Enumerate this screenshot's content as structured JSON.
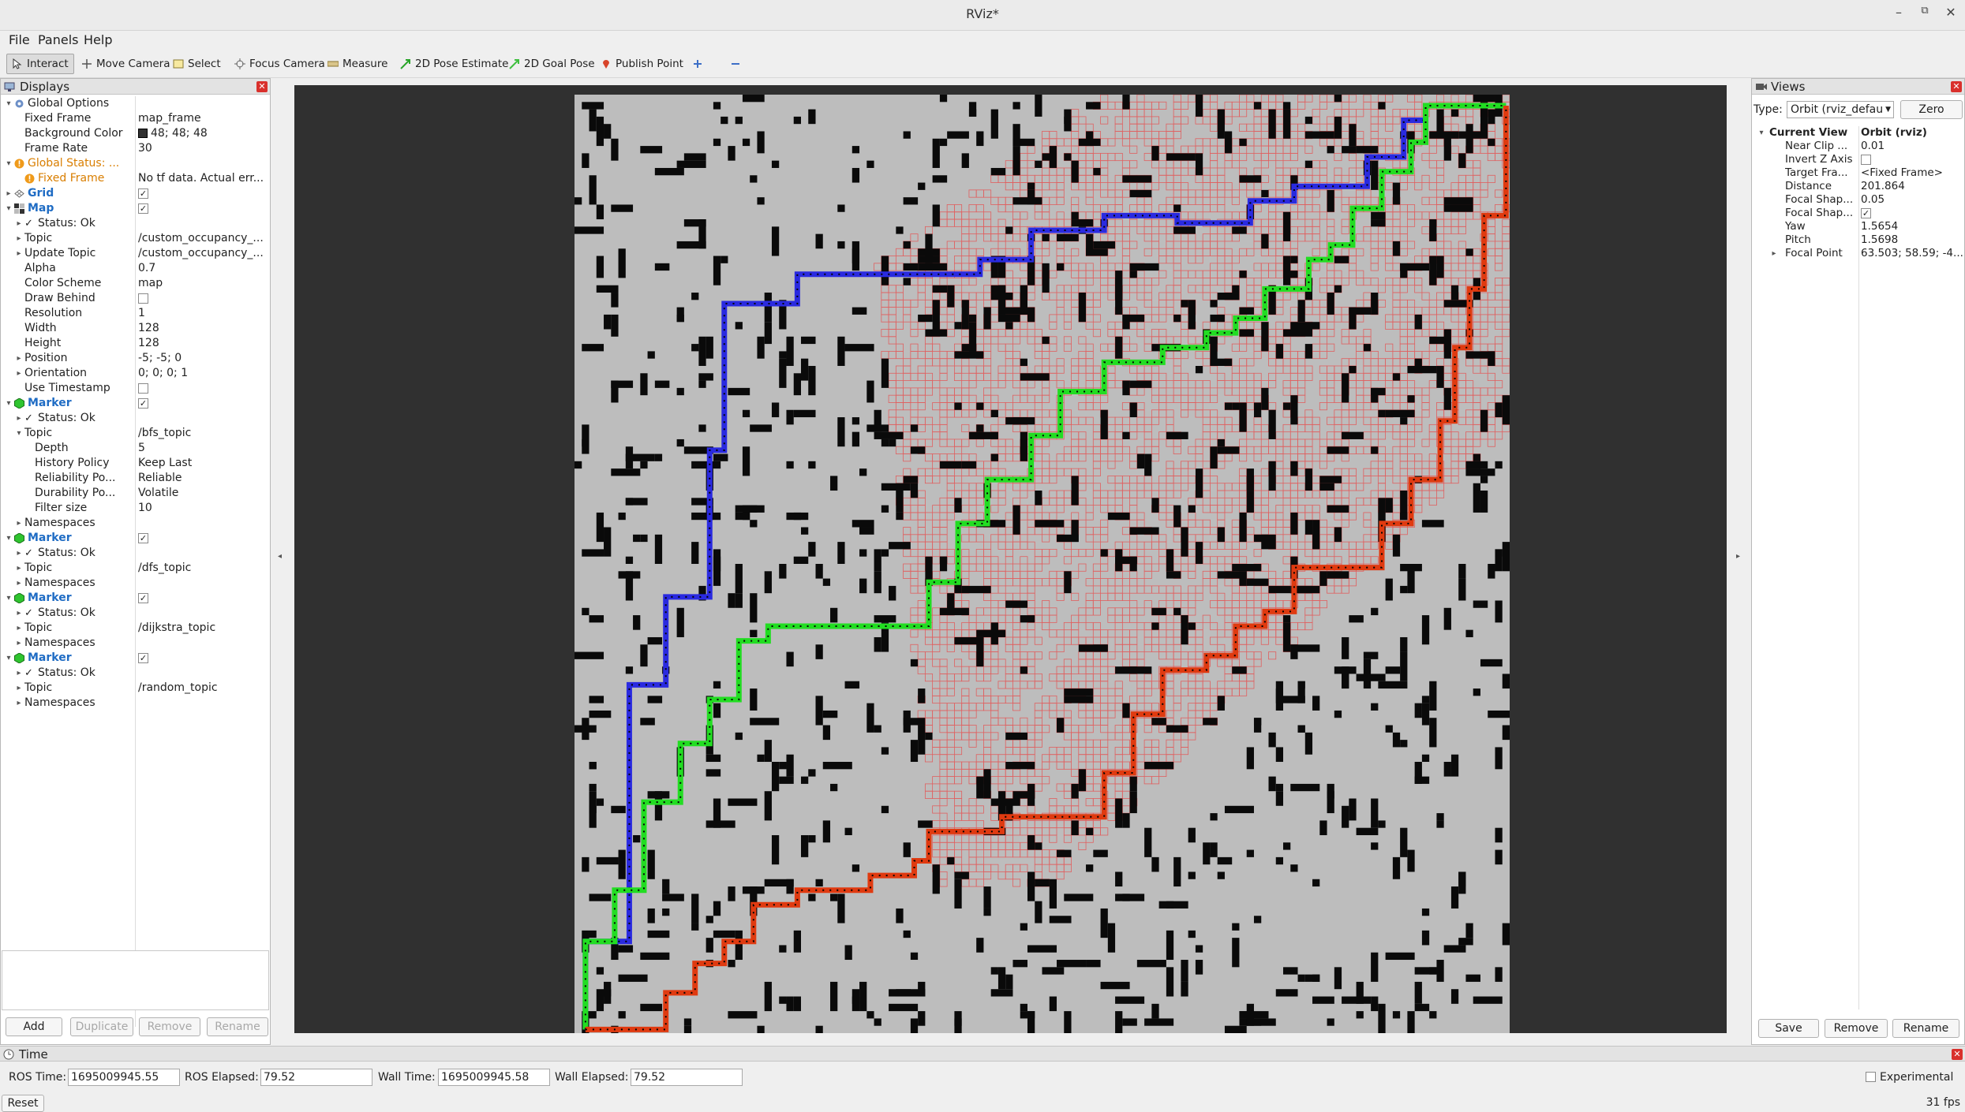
{
  "window": {
    "title": "RViz*"
  },
  "menu": [
    "File",
    "Panels",
    "Help"
  ],
  "toolbar": {
    "interact": "Interact",
    "move_camera": "Move Camera",
    "select": "Select",
    "focus_camera": "Focus Camera",
    "measure": "Measure",
    "pose_estimate": "2D Pose Estimate",
    "goal_pose": "2D Goal Pose",
    "publish_point": "Publish Point"
  },
  "displays": {
    "title": "Displays",
    "rows": [
      {
        "k": "Global Options",
        "v": "",
        "lvl": 0,
        "exp": "open",
        "icon": "gear",
        "cls": ""
      },
      {
        "k": "Fixed Frame",
        "v": "map_frame",
        "lvl": 1
      },
      {
        "k": "Background Color",
        "v": "48; 48; 48",
        "lvl": 1,
        "swatch": "#303030"
      },
      {
        "k": "Frame Rate",
        "v": "30",
        "lvl": 1
      },
      {
        "k": "Global Status: ...",
        "v": "",
        "lvl": 0,
        "exp": "open",
        "icon": "warn",
        "cls": "orange"
      },
      {
        "k": "Fixed Frame",
        "v": "No tf data.  Actual err...",
        "lvl": 1,
        "icon": "warn",
        "cls": "orange"
      },
      {
        "k": "Grid",
        "v": "",
        "lvl": 0,
        "exp": "closed",
        "icon": "grid",
        "cls": "blue",
        "check": true
      },
      {
        "k": "Map",
        "v": "",
        "lvl": 0,
        "exp": "open",
        "icon": "map",
        "cls": "blue",
        "check": true
      },
      {
        "k": "Status: Ok",
        "v": "",
        "lvl": 1,
        "exp": "closed",
        "icon": "ok"
      },
      {
        "k": "Topic",
        "v": "/custom_occupancy_...",
        "lvl": 1,
        "exp": "closed"
      },
      {
        "k": "Update Topic",
        "v": "/custom_occupancy_...",
        "lvl": 1,
        "exp": "closed"
      },
      {
        "k": "Alpha",
        "v": "0.7",
        "lvl": 1
      },
      {
        "k": "Color Scheme",
        "v": "map",
        "lvl": 1
      },
      {
        "k": "Draw Behind",
        "v": "",
        "lvl": 1,
        "check": false
      },
      {
        "k": "Resolution",
        "v": "1",
        "lvl": 1
      },
      {
        "k": "Width",
        "v": "128",
        "lvl": 1
      },
      {
        "k": "Height",
        "v": "128",
        "lvl": 1
      },
      {
        "k": "Position",
        "v": "-5; -5; 0",
        "lvl": 1,
        "exp": "closed"
      },
      {
        "k": "Orientation",
        "v": "0; 0; 0; 1",
        "lvl": 1,
        "exp": "closed"
      },
      {
        "k": "Use Timestamp",
        "v": "",
        "lvl": 1,
        "check": false
      },
      {
        "k": "Marker",
        "v": "",
        "lvl": 0,
        "exp": "open",
        "icon": "marker",
        "cls": "blue",
        "check": true
      },
      {
        "k": "Status: Ok",
        "v": "",
        "lvl": 1,
        "exp": "closed",
        "icon": "ok"
      },
      {
        "k": "Topic",
        "v": "/bfs_topic",
        "lvl": 1,
        "exp": "open"
      },
      {
        "k": "Depth",
        "v": "5",
        "lvl": 2
      },
      {
        "k": "History Policy",
        "v": "Keep Last",
        "lvl": 2
      },
      {
        "k": "Reliability Po...",
        "v": "Reliable",
        "lvl": 2
      },
      {
        "k": "Durability Po...",
        "v": "Volatile",
        "lvl": 2
      },
      {
        "k": "Filter size",
        "v": "10",
        "lvl": 2
      },
      {
        "k": "Namespaces",
        "v": "",
        "lvl": 1,
        "exp": "closed"
      },
      {
        "k": "Marker",
        "v": "",
        "lvl": 0,
        "exp": "open",
        "icon": "marker",
        "cls": "blue",
        "check": true
      },
      {
        "k": "Status: Ok",
        "v": "",
        "lvl": 1,
        "exp": "closed",
        "icon": "ok"
      },
      {
        "k": "Topic",
        "v": "/dfs_topic",
        "lvl": 1,
        "exp": "closed"
      },
      {
        "k": "Namespaces",
        "v": "",
        "lvl": 1,
        "exp": "closed"
      },
      {
        "k": "Marker",
        "v": "",
        "lvl": 0,
        "exp": "open",
        "icon": "marker",
        "cls": "blue",
        "check": true
      },
      {
        "k": "Status: Ok",
        "v": "",
        "lvl": 1,
        "exp": "closed",
        "icon": "ok"
      },
      {
        "k": "Topic",
        "v": "/dijkstra_topic",
        "lvl": 1,
        "exp": "closed"
      },
      {
        "k": "Namespaces",
        "v": "",
        "lvl": 1,
        "exp": "closed"
      },
      {
        "k": "Marker",
        "v": "",
        "lvl": 0,
        "exp": "open",
        "icon": "marker",
        "cls": "blue",
        "check": true
      },
      {
        "k": "Status: Ok",
        "v": "",
        "lvl": 1,
        "exp": "closed",
        "icon": "ok"
      },
      {
        "k": "Topic",
        "v": "/random_topic",
        "lvl": 1,
        "exp": "closed"
      },
      {
        "k": "Namespaces",
        "v": "",
        "lvl": 1,
        "exp": "closed"
      }
    ],
    "buttons": {
      "add": "Add",
      "duplicate": "Duplicate",
      "remove": "Remove",
      "rename": "Rename"
    }
  },
  "views": {
    "title": "Views",
    "type_label": "Type:",
    "type_value": "Orbit (rviz_defau",
    "zero": "Zero",
    "rows": [
      {
        "k": "Current View",
        "v": "Orbit (rviz)",
        "bold": true,
        "exp": "open"
      },
      {
        "k": "Near Clip ...",
        "v": "0.01"
      },
      {
        "k": "Invert Z Axis",
        "v": "",
        "check": false
      },
      {
        "k": "Target Fra...",
        "v": "<Fixed Frame>"
      },
      {
        "k": "Distance",
        "v": "201.864"
      },
      {
        "k": "Focal Shap...",
        "v": "0.05"
      },
      {
        "k": "Focal Shap...",
        "v": "",
        "check": true
      },
      {
        "k": "Yaw",
        "v": "1.5654"
      },
      {
        "k": "Pitch",
        "v": "1.5698"
      },
      {
        "k": "Focal Point",
        "v": "63.503; 58.59; -4...",
        "exp": "closed"
      }
    ],
    "buttons": {
      "save": "Save",
      "remove": "Remove",
      "rename": "Rename"
    }
  },
  "time": {
    "title": "Time",
    "ros_time_label": "ROS Time:",
    "ros_time": "1695009945.55",
    "ros_elapsed_label": "ROS Elapsed:",
    "ros_elapsed": "79.52",
    "wall_time_label": "Wall Time:",
    "wall_time": "1695009945.58",
    "wall_elapsed_label": "Wall Elapsed:",
    "wall_elapsed": "79.52",
    "experimental": "Experimental",
    "reset": "Reset",
    "fps": "31 fps"
  },
  "map": {
    "cols": 128,
    "rows": 128,
    "free_color": "#bdbdbd",
    "occupied_color": "#0a0a0a",
    "explored_color": "#e06060",
    "paths": [
      {
        "topic": "/bfs_topic",
        "color": "#2a2ae0"
      },
      {
        "topic": "/dfs_topic",
        "color": "#22dd22"
      },
      {
        "topic": "/dijkstra_topic",
        "color": "#e03a10"
      },
      {
        "topic": "/random_topic",
        "color": "#ff3030"
      }
    ]
  }
}
